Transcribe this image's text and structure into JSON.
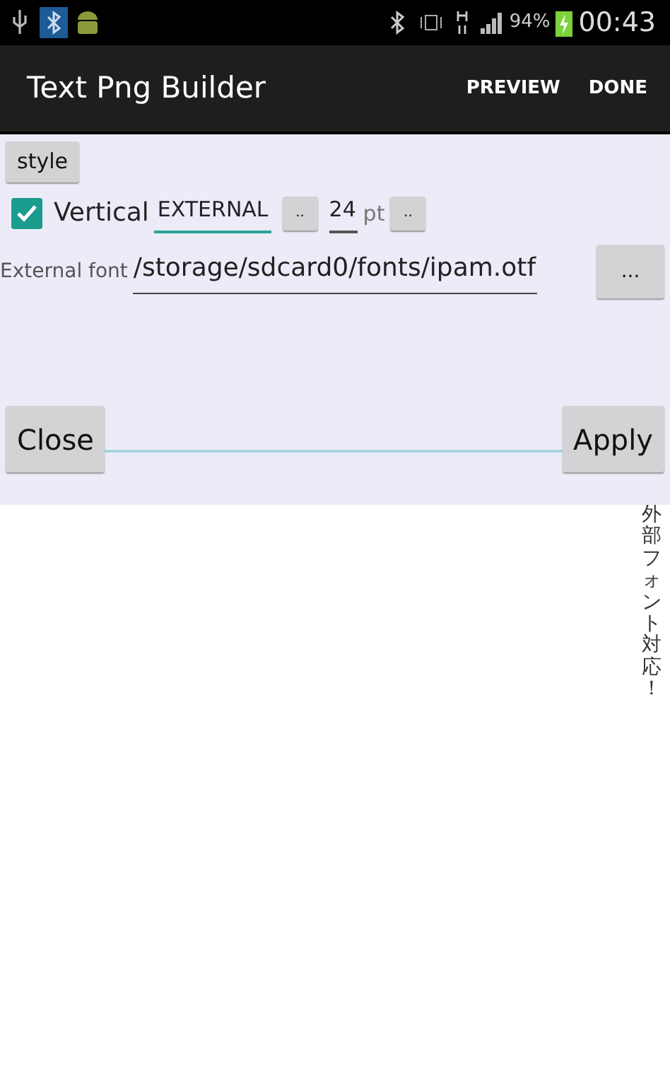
{
  "status_bar": {
    "battery": "94%",
    "time": "00:43"
  },
  "action_bar": {
    "title": "Text Png Builder",
    "actions": [
      "PREVIEW",
      "DONE"
    ]
  },
  "style_button": "style",
  "vertical": {
    "label": "Vertical",
    "checked": true
  },
  "font_select": {
    "value": "EXTERNAL",
    "button": ".."
  },
  "size": {
    "value": "24",
    "unit": "pt",
    "button": ".."
  },
  "external_font": {
    "label": "External font",
    "value": "/storage/sdcard0/fonts/ipam.otf",
    "button": "..."
  },
  "buttons": [
    "Close",
    "Apply"
  ],
  "preview_text": "外部フォント対応！"
}
